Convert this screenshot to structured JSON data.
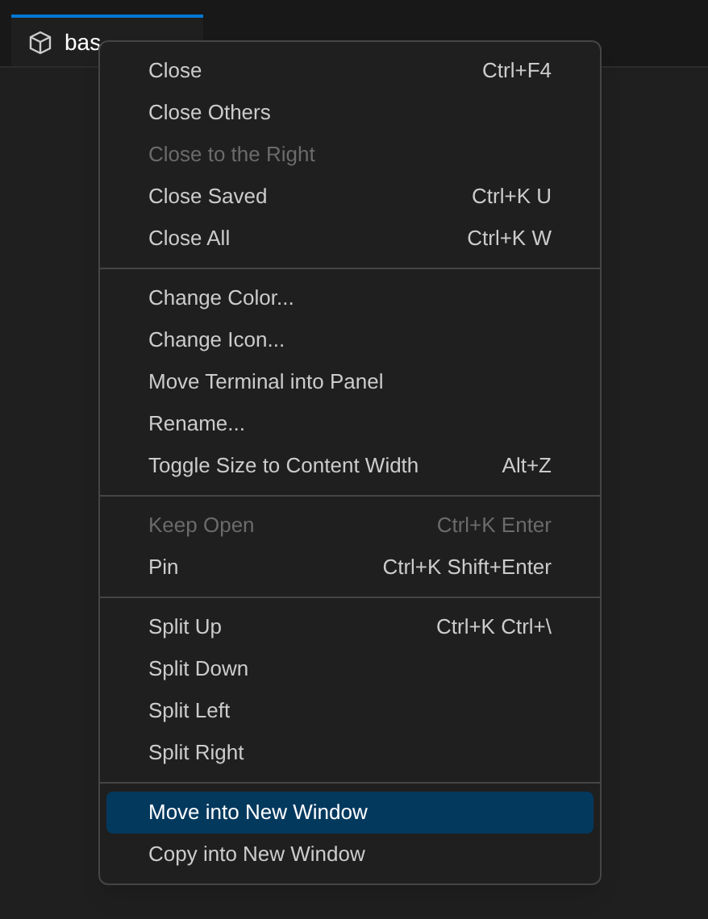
{
  "tab": {
    "label": "bas",
    "selected": true
  },
  "menu": {
    "groups": [
      {
        "items": [
          {
            "label": "Close",
            "shortcut": "Ctrl+F4",
            "disabled": false,
            "selected": false
          },
          {
            "label": "Close Others",
            "disabled": false,
            "selected": false
          },
          {
            "label": "Close to the Right",
            "disabled": true,
            "selected": false
          },
          {
            "label": "Close Saved",
            "shortcut": "Ctrl+K U",
            "disabled": false,
            "selected": false
          },
          {
            "label": "Close All",
            "shortcut": "Ctrl+K W",
            "disabled": false,
            "selected": false
          }
        ]
      },
      {
        "items": [
          {
            "label": "Change Color...",
            "disabled": false,
            "selected": false
          },
          {
            "label": "Change Icon...",
            "disabled": false,
            "selected": false
          },
          {
            "label": "Move Terminal into Panel",
            "disabled": false,
            "selected": false
          },
          {
            "label": "Rename...",
            "disabled": false,
            "selected": false
          },
          {
            "label": "Toggle Size to Content Width",
            "shortcut": "Alt+Z",
            "disabled": false,
            "selected": false
          }
        ]
      },
      {
        "items": [
          {
            "label": "Keep Open",
            "shortcut": "Ctrl+K Enter",
            "disabled": true,
            "selected": false
          },
          {
            "label": "Pin",
            "shortcut": "Ctrl+K Shift+Enter",
            "disabled": false,
            "selected": false
          }
        ]
      },
      {
        "items": [
          {
            "label": "Split Up",
            "shortcut": "Ctrl+K Ctrl+\\",
            "disabled": false,
            "selected": false
          },
          {
            "label": "Split Down",
            "disabled": false,
            "selected": false
          },
          {
            "label": "Split Left",
            "disabled": false,
            "selected": false
          },
          {
            "label": "Split Right",
            "disabled": false,
            "selected": false
          }
        ]
      },
      {
        "items": [
          {
            "label": "Move into New Window",
            "disabled": false,
            "selected": true
          },
          {
            "label": "Copy into New Window",
            "disabled": false,
            "selected": false
          }
        ]
      }
    ]
  }
}
